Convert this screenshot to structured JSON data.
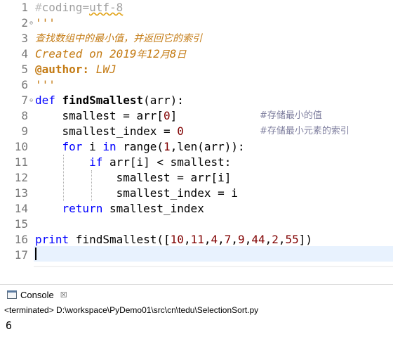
{
  "editor": {
    "line_numbers": [
      "1",
      "2",
      "3",
      "4",
      "5",
      "6",
      "7",
      "8",
      "9",
      "10",
      "11",
      "12",
      "13",
      "14",
      "15",
      "16",
      "17"
    ],
    "line1": {
      "hash": "#",
      "text": "coding=",
      "enc": "utf-8"
    },
    "line2": "'''",
    "line3": "查找数组中的最小值，并返回它的索引",
    "line4": {
      "a": "Created on 2019",
      "b": "年",
      "c": "12",
      "d": "月",
      "e": "8",
      "f": "日"
    },
    "line5": {
      "tag": "@author:",
      "name": " LWJ"
    },
    "line6": "'''",
    "line7": {
      "kw": "def",
      "fname": "findSmallest",
      "params": "(arr):"
    },
    "line8": {
      "text": "smallest = arr[",
      "num": "0",
      "close": "]",
      "comment": "#存储最小的值"
    },
    "line9": {
      "text": "smallest_index = ",
      "num": "0",
      "comment": "#存储最小元素的索引"
    },
    "line10": {
      "kw1": "for",
      "mid": " i ",
      "kw2": "in",
      "call": " range(",
      "n1": "1",
      "rest": ",len(arr)):"
    },
    "line11": {
      "kw": "if",
      "text": " arr[i] < smallest:"
    },
    "line12": "smallest = arr[i]",
    "line13": "smallest_index = i",
    "line14": {
      "kw": "return",
      "text": " smallest_index"
    },
    "line16": {
      "kw": "print",
      "open": " findSmallest([",
      "nums": [
        "10",
        "11",
        "4",
        "7",
        "9",
        "44",
        "2",
        "55"
      ],
      "close": "])"
    },
    "hscroll_left": "<"
  },
  "console": {
    "tab_label": "Console",
    "close_label": "☒",
    "status": "<terminated> D:\\workspace\\PyDemo01\\src\\cn\\tedu\\SelectionSort.py",
    "output": "6"
  }
}
